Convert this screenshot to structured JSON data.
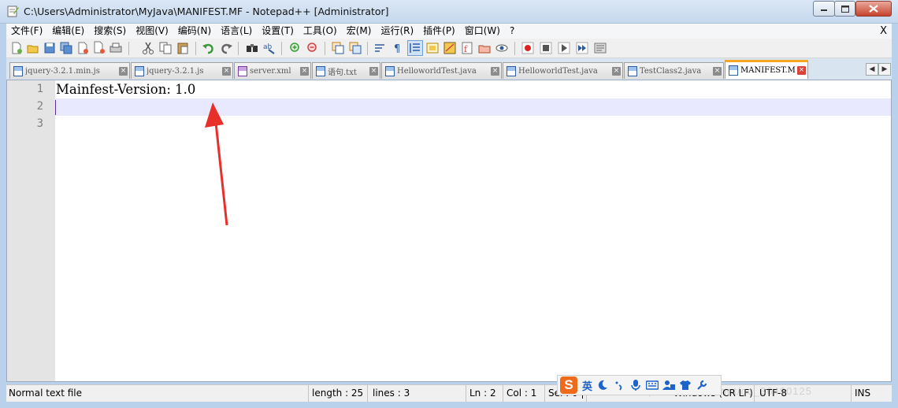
{
  "window": {
    "title": "C:\\Users\\Administrator\\MyJava\\MANIFEST.MF - Notepad++ [Administrator]"
  },
  "menu": {
    "items": [
      "文件(F)",
      "编辑(E)",
      "搜索(S)",
      "视图(V)",
      "编码(N)",
      "语言(L)",
      "设置(T)",
      "工具(O)",
      "宏(M)",
      "运行(R)",
      "插件(P)",
      "窗口(W)",
      "?"
    ],
    "close_label": "X"
  },
  "toolbar": {
    "icons": [
      "new-file-icon",
      "open-file-icon",
      "save-icon",
      "save-all-icon",
      "close-file-icon",
      "close-all-icon",
      "print-icon",
      "cut-icon",
      "copy-icon",
      "paste-icon",
      "undo-icon",
      "redo-icon",
      "find-icon",
      "replace-icon",
      "zoom-in-icon",
      "zoom-out-icon",
      "sync-vertical-icon",
      "sync-horizontal-icon",
      "word-wrap-icon",
      "show-all-chars-icon",
      "indent-guide-icon",
      "user-lang-icon",
      "doc-map-icon",
      "function-list-icon",
      "folder-workspace-icon",
      "monitoring-icon",
      "record-macro-icon",
      "stop-record-icon",
      "play-macro-icon",
      "run-macro-multiple-icon",
      "save-macro-icon"
    ]
  },
  "tabs": [
    {
      "label": "jquery-3.2.1.min.js",
      "active": false
    },
    {
      "label": "jquery-3.2.1.js",
      "active": false
    },
    {
      "label": "server.xml",
      "active": false
    },
    {
      "label": "语句.txt",
      "active": false
    },
    {
      "label": "HelloworldTest.java",
      "active": false
    },
    {
      "label": "HelloworldTest.java",
      "active": false
    },
    {
      "label": "TestClass2.java",
      "active": false
    },
    {
      "label": "MANIFEST.MF",
      "active": true
    }
  ],
  "editor": {
    "lines": [
      {
        "number": "1",
        "text": "Mainfest-Version: 1.0"
      },
      {
        "number": "2",
        "text": ""
      },
      {
        "number": "3",
        "text": ""
      }
    ]
  },
  "status": {
    "file_type": "Normal text file",
    "length": "length : 25",
    "lines": "lines : 3",
    "ln": "Ln : 2",
    "col": "Col : 1",
    "sel": "Sel : 0 | 0",
    "eol": "Windows (CR LF)",
    "encoding": "UTF-8",
    "mode": "INS"
  },
  "ime": {
    "logo": "S",
    "lang": "英"
  },
  "watermark": "http://blog.csdn.net/qq_36490125",
  "colors": {
    "accent_tab": "#f6a623",
    "current_line": "#e8e8ff",
    "annotation_arrow": "#e8302a"
  }
}
